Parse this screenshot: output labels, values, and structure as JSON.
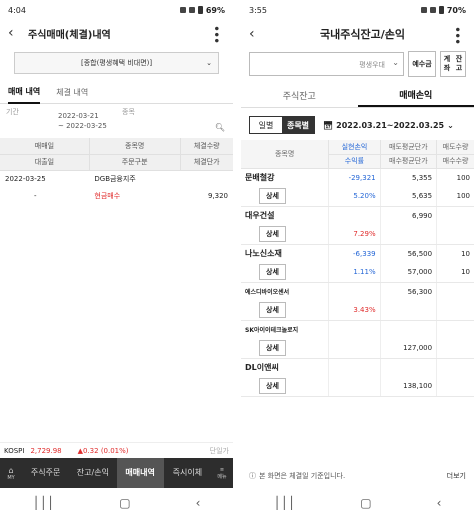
{
  "left": {
    "status": {
      "time": "4:04",
      "battery": "69%"
    },
    "title": "주식매매(체결)내역",
    "account": "[종합(평생혜택 비대면)]",
    "tabs": [
      "매매 내역",
      "체결 내역"
    ],
    "period_label": "기간",
    "item_label": "종목",
    "date_from": "2022-03-21",
    "date_to": "~ 2022-03-25",
    "table_head_1": [
      "매매일",
      "종목명",
      "체결수량"
    ],
    "table_head_2": [
      "대출일",
      "주문구분",
      "체결단가"
    ],
    "row": {
      "date": "2022-03-25",
      "name": "DGB금융지주",
      "qty": "",
      "loan": "-",
      "order_type": "현금매수",
      "price": "9,320"
    },
    "kospi": {
      "label": "KOSPI",
      "value": "2,729.98",
      "change": "▲0.32 (0.01%)",
      "unit": "단일가"
    },
    "nav": {
      "home": "MY",
      "menu": "메뉴",
      "items": [
        "주식주문",
        "잔고/손익",
        "매매내역",
        "즉시이체"
      ]
    }
  },
  "right": {
    "status": {
      "time": "3:55",
      "battery": "70%"
    },
    "title": "국내주식잔고/손익",
    "account_placeholder": "평생우대",
    "deposit_btn": "예수금",
    "acct_btn_1": "계좌",
    "acct_btn_2": "잔고",
    "tabs": [
      "주식잔고",
      "매매손익"
    ],
    "seg": [
      "일별",
      "종목별"
    ],
    "date_range": "2022.03.21~2022.03.25",
    "head": {
      "name": "종목명",
      "c1a": "실현손익",
      "c1b": "수익률",
      "c2a": "매도평균단가",
      "c2b": "매수평균단가",
      "c3a": "매도수량",
      "c3b": "매수수량"
    },
    "detail_label": "상세",
    "rows": [
      {
        "name": "문배철강",
        "profit": "-29,321",
        "rate": "5.20%",
        "sell_avg": "5,355",
        "buy_avg": "5,635",
        "sell_qty": "100",
        "buy_qty": "100",
        "profit_color": "blue",
        "rate_color": "blue"
      },
      {
        "name": "대우건설",
        "profit": "",
        "rate": "7.29%",
        "sell_avg": "6,990",
        "buy_avg": "",
        "sell_qty": "",
        "buy_qty": "",
        "profit_color": "red",
        "rate_color": "red"
      },
      {
        "name": "나노신소재",
        "profit": "-6,339",
        "rate": "1.11%",
        "sell_avg": "56,500",
        "buy_avg": "57,000",
        "sell_qty": "10",
        "buy_qty": "10",
        "profit_color": "blue",
        "rate_color": "blue"
      },
      {
        "name": "에스디바이오센서",
        "profit": "",
        "rate": "3.43%",
        "sell_avg": "56,300",
        "buy_avg": "",
        "sell_qty": "",
        "buy_qty": "",
        "profit_color": "red",
        "rate_color": "red"
      },
      {
        "name": "SK아이이테크놀로지",
        "profit": "",
        "rate": "",
        "sell_avg": "",
        "buy_avg": "127,000",
        "sell_qty": "",
        "buy_qty": "",
        "profit_color": "red",
        "rate_color": "red"
      },
      {
        "name": "DL이앤씨",
        "profit": "",
        "rate": "",
        "sell_avg": "",
        "buy_avg": "138,100",
        "sell_qty": "",
        "buy_qty": "",
        "profit_color": "red",
        "rate_color": "red"
      }
    ],
    "notice": "본 화면은 체결일 기준입니다.",
    "more": "더보기"
  },
  "colors": {
    "red": "#e02b2b",
    "blue": "#2466d6",
    "nav_bg": "#2d2d2d"
  }
}
